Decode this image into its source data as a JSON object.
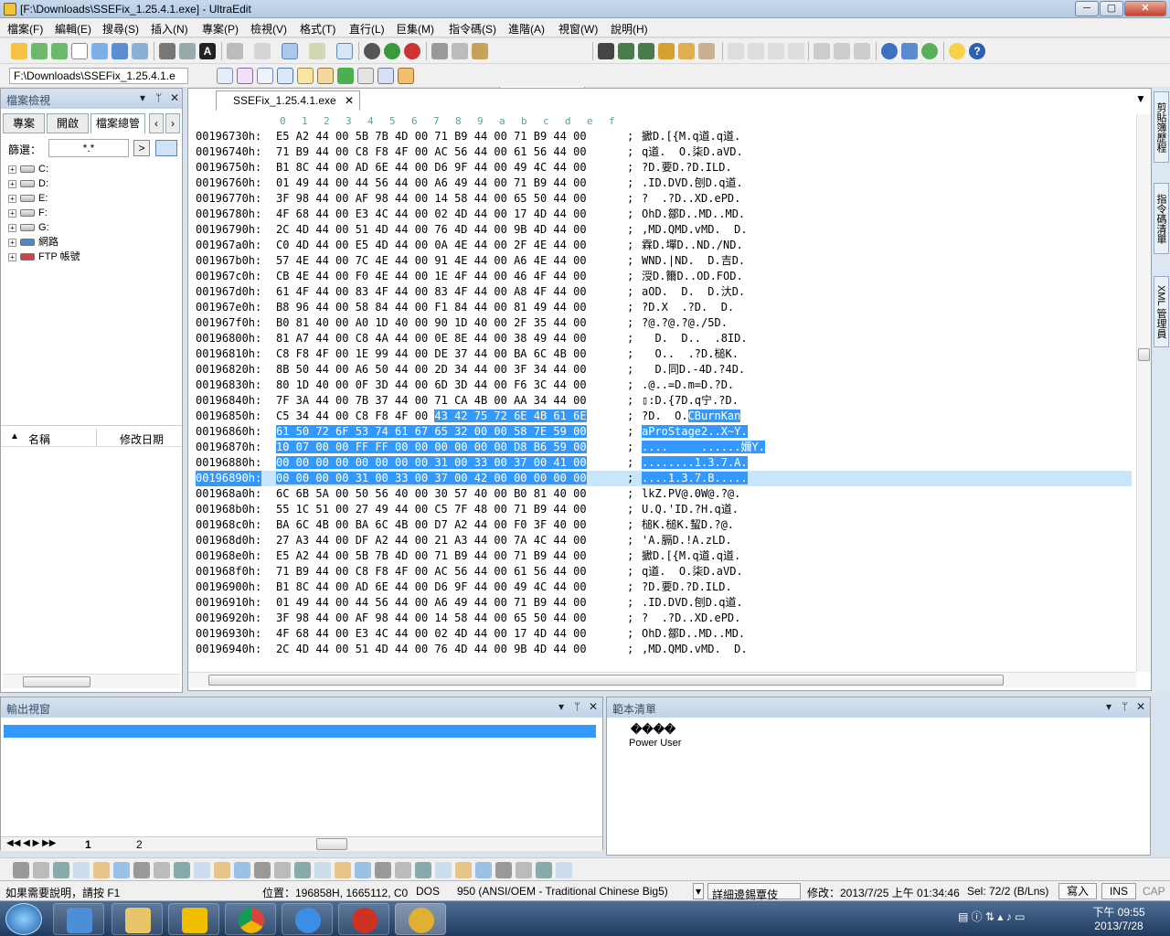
{
  "window": {
    "title": "[F:\\Downloads\\SSEFix_1.25.4.1.exe] - UltraEdit",
    "min": "─",
    "max": "▢",
    "close": "✕"
  },
  "menu": [
    "檔案(F)",
    "編輯(E)",
    "搜尋(S)",
    "插入(N)",
    "專案(P)",
    "檢視(V)",
    "格式(T)",
    "直行(L)",
    "巨集(M)",
    "指令碼(S)",
    "進階(A)",
    "視窗(W)",
    "說明(H)"
  ],
  "pathbox": "F:\\Downloads\\SSEFix_1.25.4.1.e",
  "filetree": {
    "header": "檔案檢視",
    "tabs": [
      "專案",
      "開啟",
      "檔案總管"
    ],
    "filter_label": "篩選：",
    "filter_value": "*.*",
    "items": [
      "C:",
      "D:",
      "E:",
      "F:",
      "G:",
      "網路",
      "FTP 帳號"
    ],
    "list_cols": [
      "名稱",
      "修改日期"
    ]
  },
  "editor": {
    "tab": "SSEFix_1.25.4.1.exe",
    "ruler": [
      "0",
      "1",
      "2",
      "3",
      "4",
      "5",
      "6",
      "7",
      "8",
      "9",
      "a",
      "b",
      "c",
      "d",
      "e",
      "f"
    ],
    "rows": [
      {
        "a": "00196730h:",
        "b": "E5 A2 44 00 5B 7B 4D 00 71 B9 44 00 71 B9 44 00",
        "t": "擨D.[{M.q道.q道."
      },
      {
        "a": "00196740h:",
        "b": "71 B9 44 00 C8 F8 4F 00 AC 56 44 00 61 56 44 00",
        "t": "q道.  O.柒D.aVD."
      },
      {
        "a": "00196750h:",
        "b": "B1 8C 44 00 AD 6E 44 00 D6 9F 44 00 49 4C 44 00",
        "t": "?D.要D.?D.ILD."
      },
      {
        "a": "00196760h:",
        "b": "01 49 44 00 44 56 44 00 A6 49 44 00 71 B9 44 00",
        "t": ".ID.DVD.刨D.q道."
      },
      {
        "a": "00196770h:",
        "b": "3F 98 44 00 AF 98 44 00 14 58 44 00 65 50 44 00",
        "t": "?  .?D..XD.ePD."
      },
      {
        "a": "00196780h:",
        "b": "4F 68 44 00 E3 4C 44 00 02 4D 44 00 17 4D 44 00",
        "t": "OhD.鄒D..MD..MD."
      },
      {
        "a": "00196790h:",
        "b": "2C 4D 44 00 51 4D 44 00 76 4D 44 00 9B 4D 44 00",
        "t": ",MD.QMD.vMD.  D."
      },
      {
        "a": "001967a0h:",
        "b": "C0 4D 44 00 E5 4D 44 00 0A 4E 44 00 2F 4E 44 00",
        "t": "霖D.墠D..ND./ND."
      },
      {
        "a": "001967b0h:",
        "b": "57 4E 44 00 7C 4E 44 00 91 4E 44 00 A6 4E 44 00",
        "t": "WND.|ND.  D.吉D."
      },
      {
        "a": "001967c0h:",
        "b": "CB 4E 44 00 F0 4E 44 00 1E 4F 44 00 46 4F 44 00",
        "t": "涭D.籋D..OD.FOD."
      },
      {
        "a": "001967d0h:",
        "b": "61 4F 44 00 83 4F 44 00 83 4F 44 00 A8 4F 44 00",
        "t": "aOD.  D.  D.汏D."
      },
      {
        "a": "001967e0h:",
        "b": "B8 96 44 00 58 84 44 00 F1 84 44 00 81 49 44 00",
        "t": "?D.X  .?D.  D."
      },
      {
        "a": "001967f0h:",
        "b": "B0 81 40 00 A0 1D 40 00 90 1D 40 00 2F 35 44 00",
        "t": "?@.?@.?@./5D."
      },
      {
        "a": "00196800h:",
        "b": "81 A7 44 00 C8 4A 44 00 0E 8E 44 00 38 49 44 00",
        "t": "  D.  D..  .8ID."
      },
      {
        "a": "00196810h:",
        "b": "C8 F8 4F 00 1E 99 44 00 DE 37 44 00 BA 6C 4B 00",
        "t": "  O..  .?D.槌K."
      },
      {
        "a": "00196820h:",
        "b": "8B 50 44 00 A6 50 44 00 2D 34 44 00 3F 34 44 00",
        "t": "  D.同D.-4D.?4D."
      },
      {
        "a": "00196830h:",
        "b": "80 1D 40 00 0F 3D 44 00 6D 3D 44 00 F6 3C 44 00",
        "t": ".@..=D.m=D.?D."
      },
      {
        "a": "00196840h:",
        "b": "7F 3A 44 00 7B 37 44 00 71 CA 4B 00 AA 34 44 00",
        "t": "▯:D.{7D.q宁.?D."
      },
      {
        "a": "00196850h:",
        "b": "C5 34 44 00 C8 F8 4F 00 43 42 75 72 6E 4B 61 6E",
        "t": "?D.  O.CBurnKan",
        "sel": "partial"
      },
      {
        "a": "00196860h:",
        "b": "61 50 72 6F 53 74 61 67 65 32 00 00 58 7E 59 00",
        "t": "aProStage2..X~Y.",
        "sel": "full"
      },
      {
        "a": "00196870h:",
        "b": "10 07 00 00 FF FF 00 00 00 00 00 00 D8 B6 59 00",
        "t": "....     ......嬭Y.",
        "sel": "full"
      },
      {
        "a": "00196880h:",
        "b": "00 00 00 00 00 00 00 00 31 00 33 00 37 00 41 00",
        "t": "........1.3.7.A.",
        "sel": "full"
      },
      {
        "a": "00196890h:",
        "b": "00 00 00 00 31 00 33 00 37 00 42 00 00 00 00 00",
        "t": "....1.3.7.B.....",
        "sel": "full",
        "current": true
      },
      {
        "a": "001968a0h:",
        "b": "6C 6B 5A 00 50 56 40 00 30 57 40 00 B0 81 40 00",
        "t": "lkZ.PV@.0W@.?@."
      },
      {
        "a": "001968b0h:",
        "b": "55 1C 51 00 27 49 44 00 C5 7F 48 00 71 B9 44 00",
        "t": "U.Q.'ID.?H.q道."
      },
      {
        "a": "001968c0h:",
        "b": "BA 6C 4B 00 BA 6C 4B 00 D7 A2 44 00 F0 3F 40 00",
        "t": "槌K.槌K.蛪D.?@."
      },
      {
        "a": "001968d0h:",
        "b": "27 A3 44 00 DF A2 44 00 21 A3 44 00 7A 4C 44 00",
        "t": "'A.膈D.!A.zLD."
      },
      {
        "a": "001968e0h:",
        "b": "E5 A2 44 00 5B 7B 4D 00 71 B9 44 00 71 B9 44 00",
        "t": "擨D.[{M.q道.q道."
      },
      {
        "a": "001968f0h:",
        "b": "71 B9 44 00 C8 F8 4F 00 AC 56 44 00 61 56 44 00",
        "t": "q道.  O.柒D.aVD."
      },
      {
        "a": "00196900h:",
        "b": "B1 8C 44 00 AD 6E 44 00 D6 9F 44 00 49 4C 44 00",
        "t": "?D.要D.?D.ILD."
      },
      {
        "a": "00196910h:",
        "b": "01 49 44 00 44 56 44 00 A6 49 44 00 71 B9 44 00",
        "t": ".ID.DVD.刨D.q道."
      },
      {
        "a": "00196920h:",
        "b": "3F 98 44 00 AF 98 44 00 14 58 44 00 65 50 44 00",
        "t": "?  .?D..XD.ePD."
      },
      {
        "a": "00196930h:",
        "b": "4F 68 44 00 E3 4C 44 00 02 4D 44 00 17 4D 44 00",
        "t": "OhD.鄒D..MD..MD."
      },
      {
        "a": "00196940h:",
        "b": "2C 4D 44 00 51 4D 44 00 76 4D 44 00 9B 4D 44 00",
        "t": ",MD.QMD.vMD.  D."
      }
    ]
  },
  "sidetabs": [
    "剪貼簿歷程",
    "指令碼清單",
    "XML 管理員"
  ],
  "output": {
    "header": "輸出視窗",
    "tabs": [
      "1",
      "2"
    ]
  },
  "templates": {
    "header": "範本清單",
    "items": [
      "����",
      "Power User"
    ]
  },
  "status": {
    "help": "如果需要說明，請按 F1",
    "position": "位置：196858H, 1665112, C0",
    "lineend": "DOS",
    "codepage": "950  (ANSI/OEM - Traditional Chinese Big5)",
    "highlight": "詳細邊錫覃伎",
    "modified": "修改：2013/7/25 上午 01:34:46",
    "selection": "Sel: 72/2 (B/Lns)",
    "write": "寫入",
    "ins": "INS",
    "cap": "CAP"
  },
  "clock": {
    "time": "下午 09:55",
    "date": "2013/7/28"
  },
  "colors": {
    "selection": "#3399ff",
    "current_line": "#c8e6fb",
    "title": "#c6d8ec",
    "taskbar": "#2f4c73"
  }
}
